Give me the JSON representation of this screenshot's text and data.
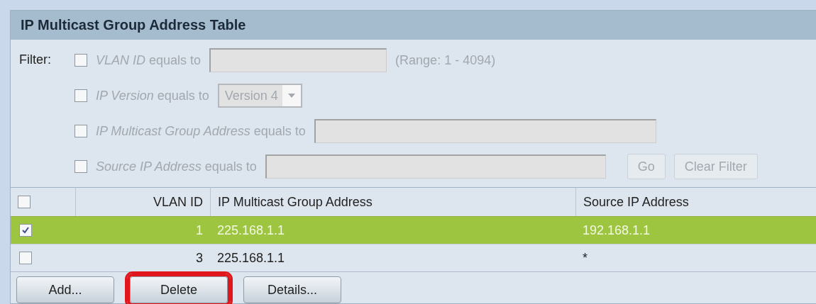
{
  "panel": {
    "title": "IP Multicast Group Address Table"
  },
  "filter": {
    "label": "Filter:",
    "rows": [
      {
        "kind": "text",
        "label": "*VLAN ID* equals to",
        "checked": false,
        "hint": "(Range: 1 - 4094)"
      },
      {
        "kind": "select",
        "label": "*IP Version* equals to",
        "checked": false,
        "value": "Version 4"
      },
      {
        "kind": "text",
        "label": "*IP Multicast Group Address* equals to",
        "checked": false
      },
      {
        "kind": "text",
        "label": "*Source IP Address* equals to",
        "checked": false
      }
    ],
    "buttons": [
      {
        "label": "Go",
        "disabled": true
      },
      {
        "label": "Clear Filter",
        "disabled": true
      }
    ]
  },
  "table": {
    "select_all": false,
    "columns": [
      "VLAN ID",
      "IP Multicast Group Address",
      "Source IP Address"
    ],
    "rows": [
      {
        "selected": true,
        "cells": [
          "1",
          "225.168.1.1",
          "192.168.1.1"
        ]
      },
      {
        "selected": false,
        "cells": [
          "3",
          "225.168.1.1",
          "*"
        ]
      }
    ]
  },
  "actions": [
    {
      "label": "Add...",
      "highlighted": false
    },
    {
      "label": "Delete",
      "highlighted": true
    },
    {
      "label": "Details...",
      "highlighted": false
    }
  ]
}
